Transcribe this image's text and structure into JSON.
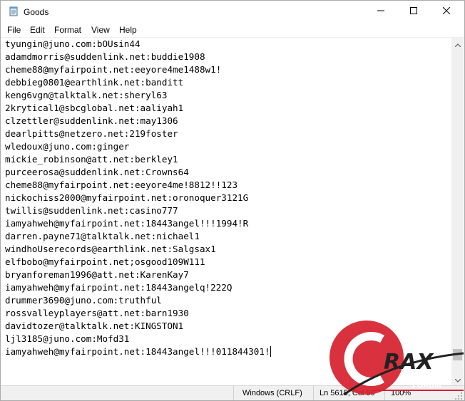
{
  "window": {
    "title": "Goods"
  },
  "menu": [
    "File",
    "Edit",
    "Format",
    "View",
    "Help"
  ],
  "editor": {
    "lines": [
      "tyungin@juno.com:bOUsin44",
      "adamdmorris@suddenlink.net:buddie1908",
      "cheme88@myfairpoint.net:eeyore4me1488w1!",
      "debbieg0801@earthlink.net:banditt",
      "keng6vgn@talktalk.net:sheryl63",
      "2krytical1@sbcglobal.net:aaliyah1",
      "clzettler@suddenlink.net:may1306",
      "dearlpitts@netzero.net:219foster",
      "wledoux@juno.com:ginger",
      "mickie_robinson@att.net:berkley1",
      "purceerosa@suddenlink.net:Crowns64",
      "cheme88@myfairpoint.net:eeyore4me!8812!!123",
      "nickochiss2000@myfairpoint.net:oronoquer3121G",
      "twillis@suddenlink.net:casino777",
      "iamyahweh@myfairpoint.net:18443angel!!!1994!R",
      "darren.payne71@talktalk.net:nichael1",
      "windhoUserecords@earthlink.net:Salgsax1",
      "elfbobo@myfairpoint.net;osgood109W111",
      "bryanforeman1996@att.net:KarenKay7",
      "iamyahweh@myfairpoint.net:18443angelq!222Q",
      "drummer3690@juno.com:truthful",
      "rossvalleyplayers@att.net:barn1930",
      "davidtozer@talktalk.net:KINGSTON1",
      "ljl3185@juno.com:Mofd31",
      "iamyahweh@myfairpoint.net:18443angel!!!011844301!"
    ]
  },
  "status": {
    "encoding": "Windows (CRLF)",
    "position": "Ln 5615, Col 50",
    "zoom": "100%"
  },
  "watermark": {
    "brand": "RAX",
    "sub": "FORUM",
    "colors": {
      "red": "#d7202e",
      "dark": "#222222"
    }
  },
  "icons": {
    "app": "notepad-icon",
    "minimize": "minimize-icon",
    "maximize": "maximize-icon",
    "close": "close-icon"
  }
}
